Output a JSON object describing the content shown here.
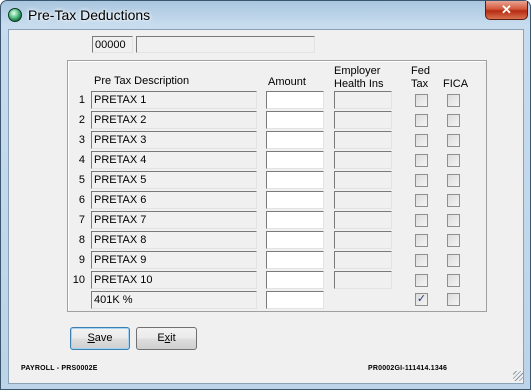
{
  "window": {
    "title": "Pre-Tax Deductions",
    "close_label": "✕"
  },
  "header": {
    "code": "00000",
    "name": ""
  },
  "columns": {
    "description": "Pre Tax Description",
    "amount": "Amount",
    "employer_line1": "Employer",
    "employer_line2": "Health Ins",
    "fed_line1": "Fed",
    "fed_line2": "Tax",
    "fica": "FICA"
  },
  "rows": [
    {
      "num": "1",
      "desc": "PRETAX 1",
      "fed": false,
      "fica": false
    },
    {
      "num": "2",
      "desc": "PRETAX 2",
      "fed": false,
      "fica": false
    },
    {
      "num": "3",
      "desc": "PRETAX 3",
      "fed": false,
      "fica": false
    },
    {
      "num": "4",
      "desc": "PRETAX 4",
      "fed": false,
      "fica": false
    },
    {
      "num": "5",
      "desc": "PRETAX 5",
      "fed": false,
      "fica": false
    },
    {
      "num": "6",
      "desc": "PRETAX 6",
      "fed": false,
      "fica": false
    },
    {
      "num": "7",
      "desc": "PRETAX 7",
      "fed": false,
      "fica": false
    },
    {
      "num": "8",
      "desc": "PRETAX 8",
      "fed": false,
      "fica": false
    },
    {
      "num": "9",
      "desc": "PRETAX 9",
      "fed": false,
      "fica": false
    },
    {
      "num": "10",
      "desc": "PRETAX 10",
      "fed": false,
      "fica": false
    }
  ],
  "k401": {
    "desc": "401K %",
    "fed": true,
    "fica": false
  },
  "buttons": {
    "save_mnemonic": "S",
    "save_rest": "ave",
    "exit_start": "E",
    "exit_mnemonic": "x",
    "exit_rest": "it"
  },
  "footer": {
    "left": "PAYROLL - PRS0002E",
    "right": "PR0002GI-111414.1346"
  }
}
